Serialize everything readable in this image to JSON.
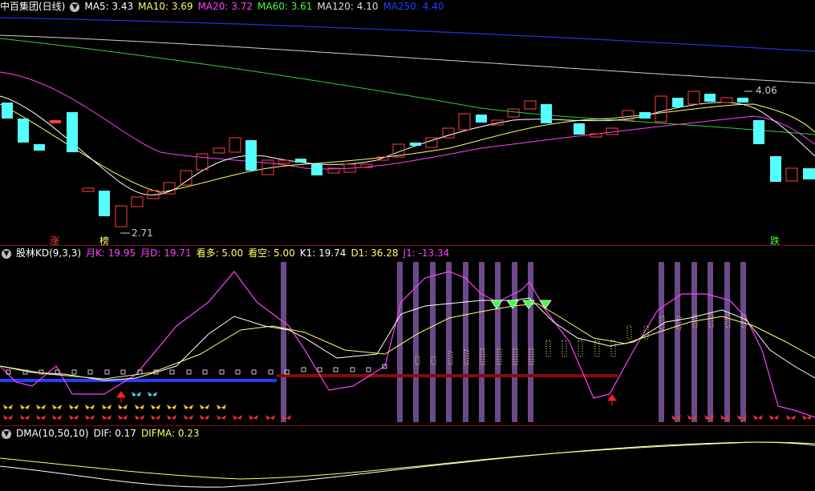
{
  "main": {
    "title": "中百集团(日线)",
    "indicators": [
      {
        "label": "MA5: 3.43",
        "color": "#ffffff"
      },
      {
        "label": "MA10: 3.69",
        "color": "#ffff66"
      },
      {
        "label": "MA20: 3.72",
        "color": "#ff40ff"
      },
      {
        "label": "MA60: 3.61",
        "color": "#40ff40"
      },
      {
        "label": "MA120: 4.10",
        "color": "#dcdcdc"
      },
      {
        "label": "MA250: 4.40",
        "color": "#2040ff"
      }
    ],
    "high_label": "4.06",
    "low_label": "2.71",
    "signal_labels": [
      "涨",
      "榜",
      "跌"
    ]
  },
  "kd": {
    "title": "股林KD(9,3,3)",
    "indicators": [
      {
        "label": "月K: 19.95",
        "color": "#ff40ff"
      },
      {
        "label": "月D: 19.71",
        "color": "#ff40ff"
      },
      {
        "label": "看多: 5.00",
        "color": "#ffff66"
      },
      {
        "label": "看空: 5.00",
        "color": "#ffff66"
      },
      {
        "label": "K1: 19.74",
        "color": "#ffffff"
      },
      {
        "label": "D1: 36.28",
        "color": "#ffff66"
      },
      {
        "label": "J1: -13.34",
        "color": "#ff40ff"
      }
    ]
  },
  "dma": {
    "title": "DMA(10,50,10)",
    "indicators": [
      {
        "label": "DIF: 0.17",
        "color": "#ffffff"
      },
      {
        "label": "DIFMA: 0.23",
        "color": "#ffff66"
      }
    ]
  },
  "colors": {
    "up": "#ff4040",
    "down": "#54ffff",
    "bg": "#000000",
    "border": "#7a1010"
  }
}
